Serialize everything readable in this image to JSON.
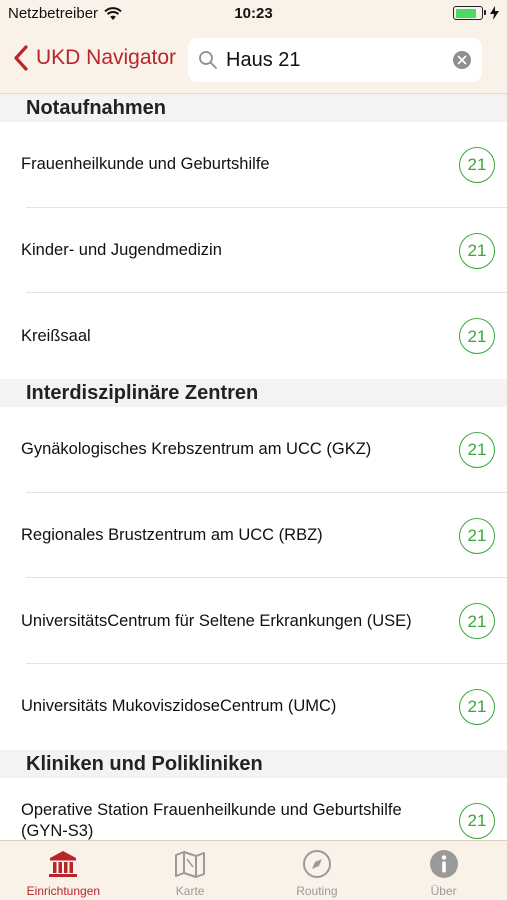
{
  "status_bar": {
    "carrier": "Netzbetreiber",
    "time": "10:23",
    "battery_percent": 80
  },
  "nav": {
    "back_label": "UKD Navigator",
    "search_value": "Haus 21"
  },
  "sections": [
    {
      "title": "Notaufnahmen",
      "rows": [
        {
          "label": "Frauenheilkunde und Geburtshilfe",
          "badge": "21"
        },
        {
          "label": "Kinder- und Jugendmedizin",
          "badge": "21"
        },
        {
          "label": "Kreißsaal",
          "badge": "21"
        }
      ]
    },
    {
      "title": "Interdisziplinäre Zentren",
      "rows": [
        {
          "label": "Gynäkologisches Krebszentrum am UCC (GKZ)",
          "badge": "21"
        },
        {
          "label": "Regionales Brustzentrum am UCC (RBZ)",
          "badge": "21"
        },
        {
          "label": "UniversitätsCentrum für Seltene Erkrankungen (USE)",
          "badge": "21"
        },
        {
          "label": "Universitäts MukoviszidoseCentrum (UMC)",
          "badge": "21"
        }
      ]
    },
    {
      "title": "Kliniken und Polikliniken",
      "rows": [
        {
          "label": "Operative Station Frauenheilkunde und Geburtshilfe (GYN-S3)",
          "badge": "21"
        }
      ]
    }
  ],
  "tabs": [
    {
      "label": "Einrichtungen",
      "icon": "building-icon",
      "active": true
    },
    {
      "label": "Karte",
      "icon": "map-icon",
      "active": false
    },
    {
      "label": "Routing",
      "icon": "compass-icon",
      "active": false
    },
    {
      "label": "Über",
      "icon": "info-icon",
      "active": false
    }
  ],
  "colors": {
    "accent": "#b8262c",
    "badge_green": "#3aa83a",
    "bar_background": "#faf2e8",
    "inactive": "#9a9a9a"
  }
}
